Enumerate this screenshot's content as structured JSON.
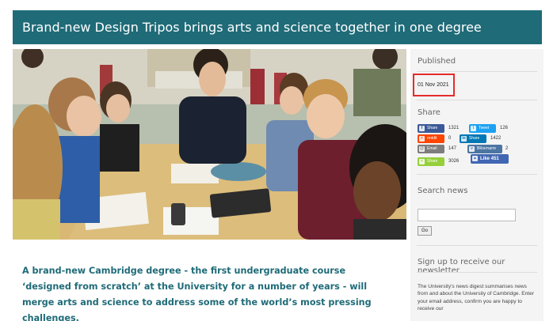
{
  "article": {
    "title": "Brand-new Design Tripos brings arts and science together in one degree",
    "intro": "A brand-new Cambridge degree - the first undergraduate course ‘designed from scratch’ at the University for a number of years - will merge arts and science to address some of the world’s most pressing challenges."
  },
  "sidebar": {
    "published": {
      "heading": "Published",
      "date": "01 Nov 2021"
    },
    "share": {
      "heading": "Share",
      "buttons": [
        {
          "network": "facebook",
          "label": "Share",
          "icon": "f",
          "count": "1321",
          "color": "#3b5998"
        },
        {
          "network": "twitter",
          "label": "Tweet",
          "icon": "t",
          "count": "126",
          "color": "#1da1f2"
        },
        {
          "network": "reddit",
          "label": "reddit",
          "icon": "r",
          "count": "0",
          "color": "#ff4500"
        },
        {
          "network": "linkedin",
          "label": "Share",
          "icon": "in",
          "count": "1422",
          "color": "#0077b5"
        },
        {
          "network": "email",
          "label": "Email",
          "icon": "@",
          "count": "147",
          "color": "#7d7d7d"
        },
        {
          "network": "vkontakte",
          "label": "ВКонтакте",
          "icon": "v",
          "count": "2",
          "color": "#4c75a3"
        },
        {
          "network": "sharethis",
          "label": "Share",
          "icon": "<",
          "count": "3026",
          "color": "#95d03a"
        }
      ],
      "like": {
        "label": "Like 451",
        "color": "#4267b2"
      }
    },
    "search": {
      "heading": "Search news",
      "placeholder": "",
      "button": "Go"
    },
    "newsletter": {
      "heading": "Sign up to receive our newsletter",
      "text": "The University's news digest summarises news from and about the University of Cambridge. Enter your email address, confirm you are happy to receive our"
    }
  },
  "colors": {
    "brand_teal": "#1f6b78",
    "highlight_red": "#e62b2b",
    "sidebar_bg": "#f4f4f4"
  },
  "icons": [
    "facebook-icon",
    "twitter-icon",
    "reddit-icon",
    "linkedin-icon",
    "email-icon",
    "vk-icon",
    "sharethis-icon",
    "thumbs-up-icon"
  ]
}
